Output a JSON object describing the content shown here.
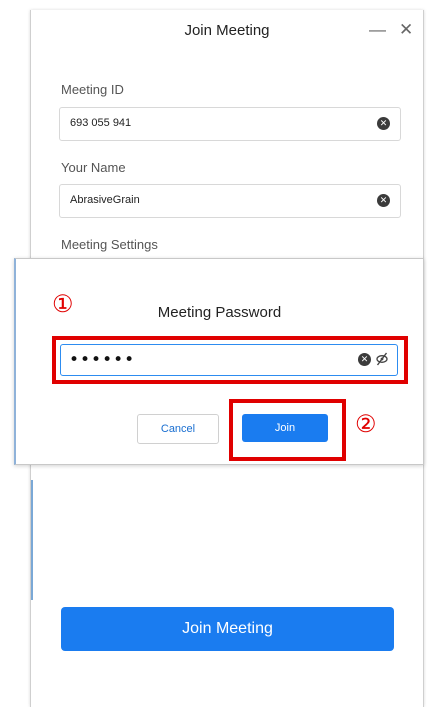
{
  "join_window": {
    "title": "Join Meeting",
    "minimize_glyph": "—",
    "close_glyph": "✕",
    "meeting_id_label": "Meeting ID",
    "meeting_id_value": "693 055 941",
    "your_name_label": "Your Name",
    "your_name_value": "AbrasiveGrain",
    "meeting_settings_label": "Meeting Settings",
    "join_meeting_button": "Join Meeting"
  },
  "password_dialog": {
    "title": "Meeting Password",
    "password_masked": "••••••",
    "cancel_button": "Cancel",
    "join_button": "Join"
  },
  "annotations": {
    "marker_1": "①",
    "marker_2": "②"
  },
  "icons": {
    "clear": "clear-icon",
    "eye_off": "eye-off-icon"
  },
  "colors": {
    "accent": "#1a7cf0",
    "annotation": "#e00000"
  }
}
